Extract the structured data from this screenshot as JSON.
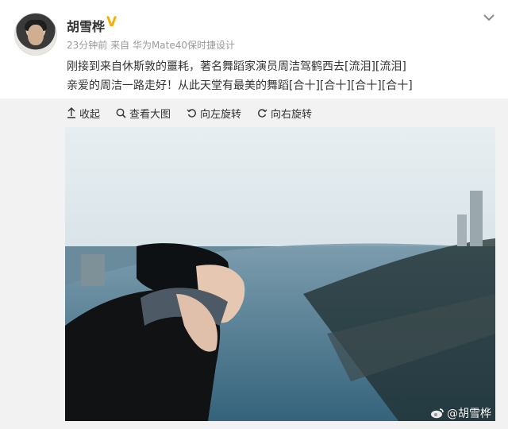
{
  "post": {
    "username": "胡雪桦",
    "verified_badge": "V",
    "time": "23分钟前",
    "source_prefix": "来自",
    "device": "华为Mate40保时捷设计",
    "line1": "刚接到来自休斯敦的噩耗，著名舞蹈家演员周洁驾鹤西去[流泪][流泪]",
    "line2": "亲爱的周洁一路走好！从此天堂有最美的舞蹈[合十][合十][合十][合十]"
  },
  "toolbar": {
    "collapse": "收起",
    "view_large": "查看大图",
    "rotate_left": "向左旋转",
    "rotate_right": "向右旋转"
  },
  "image": {
    "watermark": "@胡雪桦"
  },
  "colors": {
    "badge": "#f5b000",
    "toolbar_bg": "#f2f2f2",
    "meta_text": "#999999"
  },
  "icons": [
    "chevron-down-icon",
    "collapse-icon",
    "zoom-icon",
    "rotate-left-icon",
    "rotate-right-icon",
    "weibo-icon"
  ]
}
